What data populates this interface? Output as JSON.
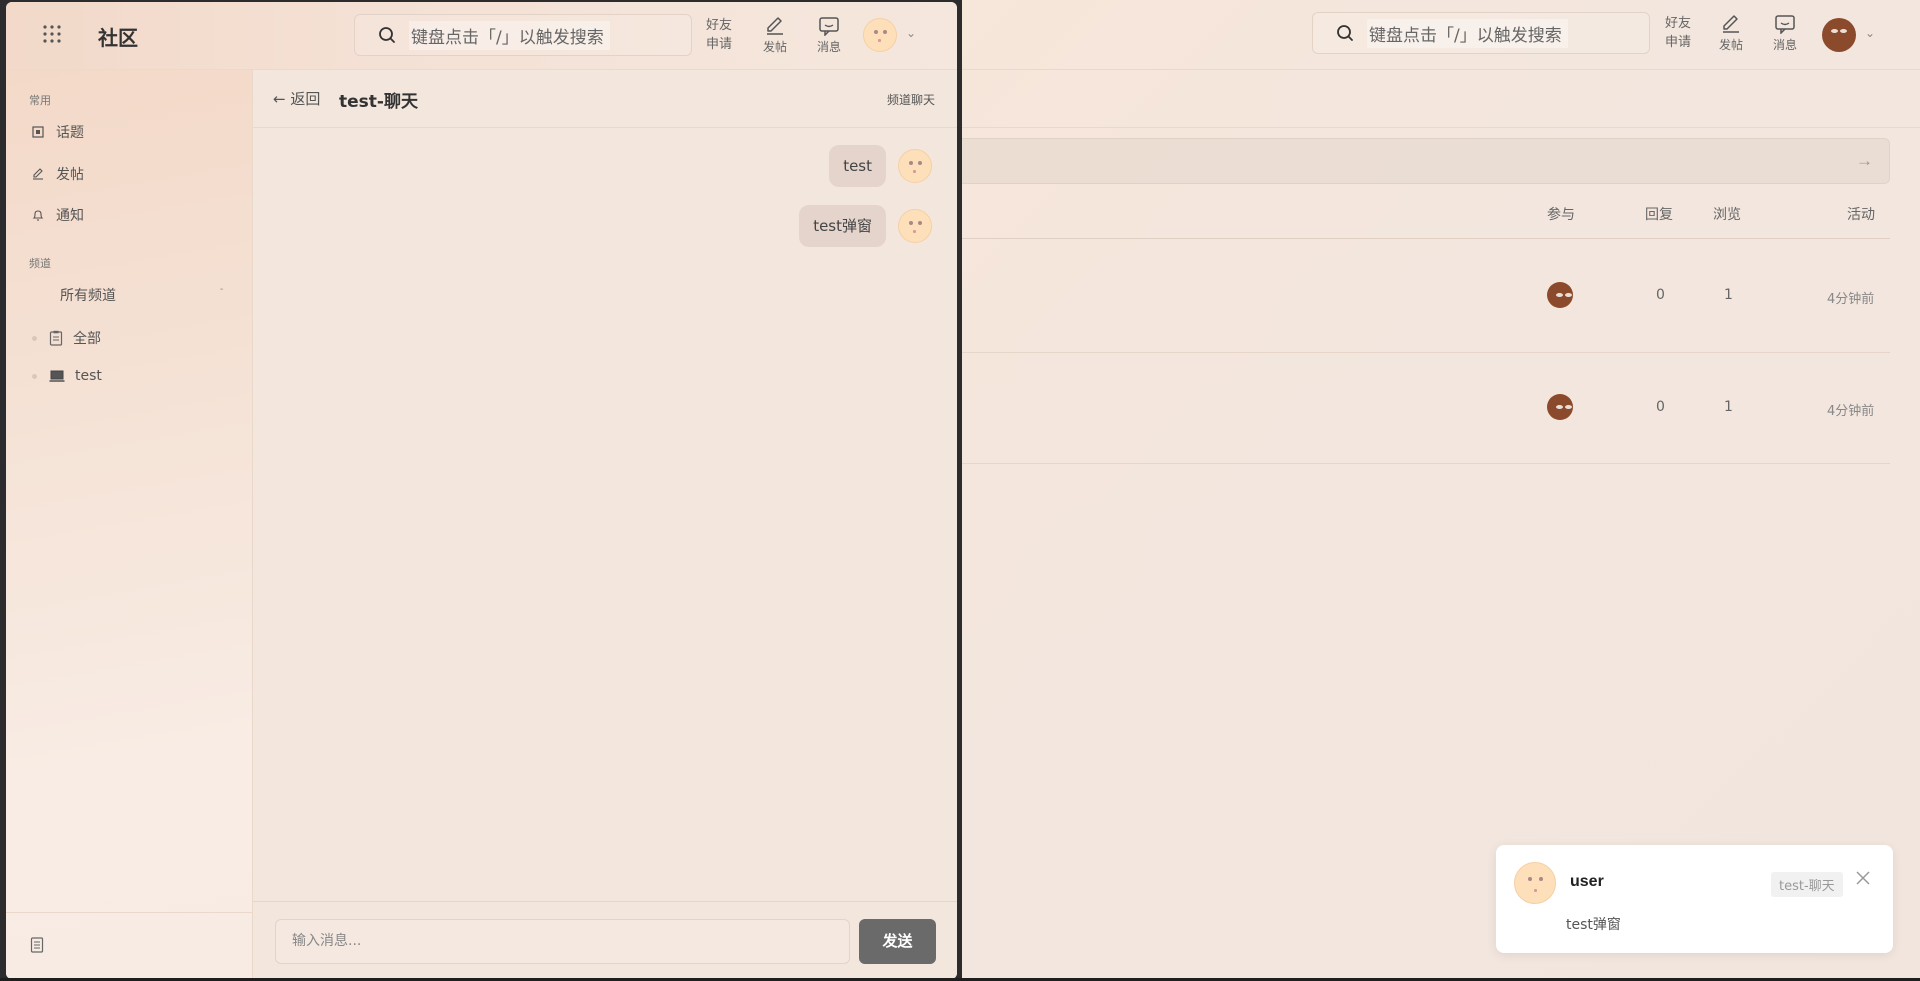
{
  "search": {
    "placeholder": "键盘点击「/」以触发搜索"
  },
  "topbar": {
    "friends_line1": "好友",
    "friends_line2": "申请",
    "post_label": "发帖",
    "messages_label": "消息"
  },
  "app": {
    "title": "社区"
  },
  "sidebar": {
    "common_section": "常用",
    "items": [
      {
        "label": "话题",
        "icon": "topic-icon"
      },
      {
        "label": "发帖",
        "icon": "pencil-icon"
      },
      {
        "label": "通知",
        "icon": "bell-icon"
      }
    ],
    "channels_section": "频道",
    "all_channels": "所有频道",
    "all_channels_toggle": "-",
    "channels": [
      {
        "label": "全部",
        "icon": "clipboard-icon"
      },
      {
        "label": "test",
        "icon": "laptop-icon"
      }
    ]
  },
  "chat": {
    "back_label": "返回",
    "back_arrow": "←",
    "title": "test-聊天",
    "type_label": "频道聊天",
    "messages": [
      {
        "text": "test"
      },
      {
        "text": "test弹窗"
      }
    ],
    "input_placeholder": "输入消息...",
    "send_label": "发送"
  },
  "table": {
    "arrow": "→",
    "columns": {
      "participants": "参与",
      "replies": "回复",
      "views": "浏览",
      "activity": "活动"
    },
    "rows": [
      {
        "replies": "0",
        "views": "1",
        "activity": "4分钟前"
      },
      {
        "replies": "0",
        "views": "1",
        "activity": "4分钟前"
      }
    ]
  },
  "toast": {
    "user": "user",
    "channel_tag": "test-聊天",
    "message": "test弹窗"
  },
  "colors": {
    "accent_send": "#6a6a6a",
    "bubble": "#e4d4cb",
    "avatar_brown": "#8b4a2b",
    "avatar_peach": "#fde0b9"
  }
}
